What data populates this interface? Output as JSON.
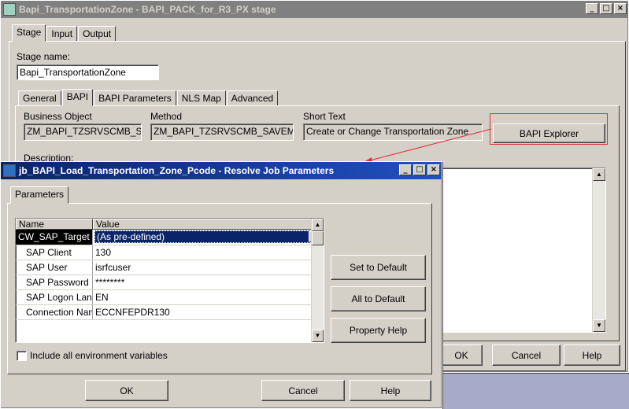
{
  "main_window": {
    "title": "Bapi_TransportationZone - BAPI_PACK_for_R3_PX stage",
    "tabs": [
      "Stage",
      "Input",
      "Output"
    ],
    "stage_name_label": "Stage name:",
    "stage_name_value": "Bapi_TransportationZone",
    "subtabs": [
      "General",
      "BAPI",
      "BAPI Parameters",
      "NLS Map",
      "Advanced"
    ],
    "business_object_label": "Business Object",
    "business_object_value": "ZM_BAPI_TZSRVSCMB_SAV",
    "method_label": "Method",
    "method_value": "ZM_BAPI_TZSRVSCMB_SAVEMULT",
    "short_text_label": "Short Text",
    "short_text_value": "Create or Change Transportation Zone",
    "bapi_explorer_button": "BAPI Explorer",
    "description_label": "Description:",
    "ok_button": "OK",
    "cancel_button": "Cancel",
    "help_button": "Help"
  },
  "dialog": {
    "title": "jb_BAPI_Load_Transportation_Zone_Pcode - Resolve Job Parameters",
    "tab": "Parameters",
    "columns": [
      "Name",
      "Value"
    ],
    "rows": [
      {
        "name": "CW_SAP_Target pa",
        "value": "(As pre-defined)"
      },
      {
        "name": "SAP Client",
        "value": "130"
      },
      {
        "name": "SAP User",
        "value": "isrfcuser"
      },
      {
        "name": "SAP Password",
        "value": "********"
      },
      {
        "name": "SAP Logon Lang",
        "value": "EN"
      },
      {
        "name": "Connection Name",
        "value": "ECCNFEPDR130"
      }
    ],
    "set_default_button": "Set to Default",
    "all_default_button": "All to Default",
    "property_help_button": "Property Help",
    "include_env_label": "Include all environment variables",
    "ok_button": "OK",
    "cancel_button": "Cancel",
    "help_button": "Help"
  },
  "colors": {
    "highlight_box": "#e03030",
    "title_active": "#0a246a"
  }
}
